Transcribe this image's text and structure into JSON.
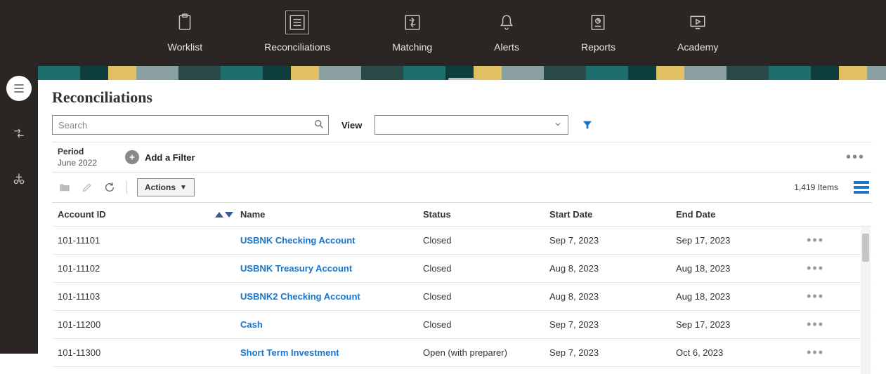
{
  "nav": {
    "items": [
      {
        "label": "Worklist"
      },
      {
        "label": "Reconciliations"
      },
      {
        "label": "Matching"
      },
      {
        "label": "Alerts"
      },
      {
        "label": "Reports"
      },
      {
        "label": "Academy"
      }
    ]
  },
  "page": {
    "title": "Reconciliations"
  },
  "search": {
    "placeholder": "Search"
  },
  "view": {
    "label": "View",
    "selected": ""
  },
  "filters": {
    "period": {
      "label": "Period",
      "value": "June 2022"
    },
    "add_label": "Add a Filter"
  },
  "actions": {
    "menu_label": "Actions",
    "items_count": "1,419 Items"
  },
  "table": {
    "columns": {
      "account_id": "Account ID",
      "name": "Name",
      "status": "Status",
      "start_date": "Start Date",
      "end_date": "End Date"
    },
    "rows": [
      {
        "account_id": "101-11101",
        "name": "USBNK Checking Account",
        "status": "Closed",
        "start_date": "Sep 7, 2023",
        "end_date": "Sep 17, 2023"
      },
      {
        "account_id": "101-11102",
        "name": "USBNK Treasury Account",
        "status": "Closed",
        "start_date": "Aug 8, 2023",
        "end_date": "Aug 18, 2023"
      },
      {
        "account_id": "101-11103",
        "name": "USBNK2 Checking Account",
        "status": "Closed",
        "start_date": "Aug 8, 2023",
        "end_date": "Aug 18, 2023"
      },
      {
        "account_id": "101-11200",
        "name": "Cash",
        "status": "Closed",
        "start_date": "Sep 7, 2023",
        "end_date": "Sep 17, 2023"
      },
      {
        "account_id": "101-11300",
        "name": "Short Term Investment",
        "status": "Open (with preparer)",
        "start_date": "Sep 7, 2023",
        "end_date": "Oct 6, 2023"
      }
    ]
  }
}
